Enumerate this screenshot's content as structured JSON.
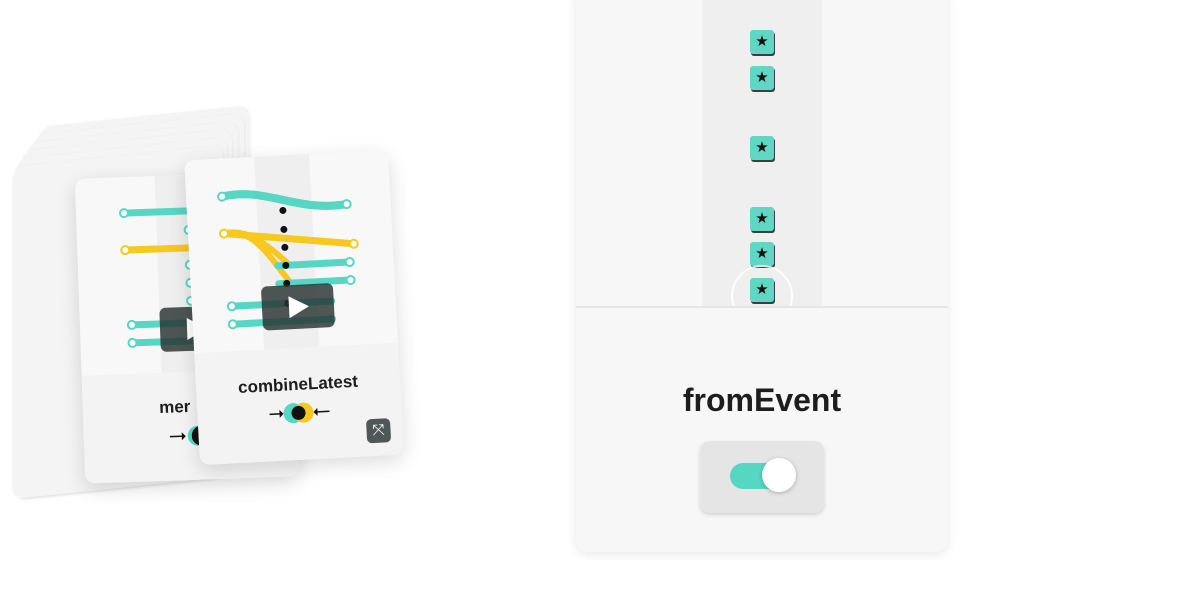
{
  "deck": {
    "back_card": {
      "title": "mer"
    },
    "front_card": {
      "title": "combineLatest"
    },
    "icons": [
      "play-icon",
      "expand-icon",
      "combine-operator-icon"
    ]
  },
  "event_card": {
    "title": "fromEvent",
    "emissions": [
      "★",
      "★",
      "★",
      "★",
      "★",
      "★"
    ],
    "toggle": {
      "state": "on"
    }
  },
  "colors": {
    "teal": "#56d7c4",
    "yellow": "#f7c81e",
    "dark": "#3a3f3f"
  }
}
